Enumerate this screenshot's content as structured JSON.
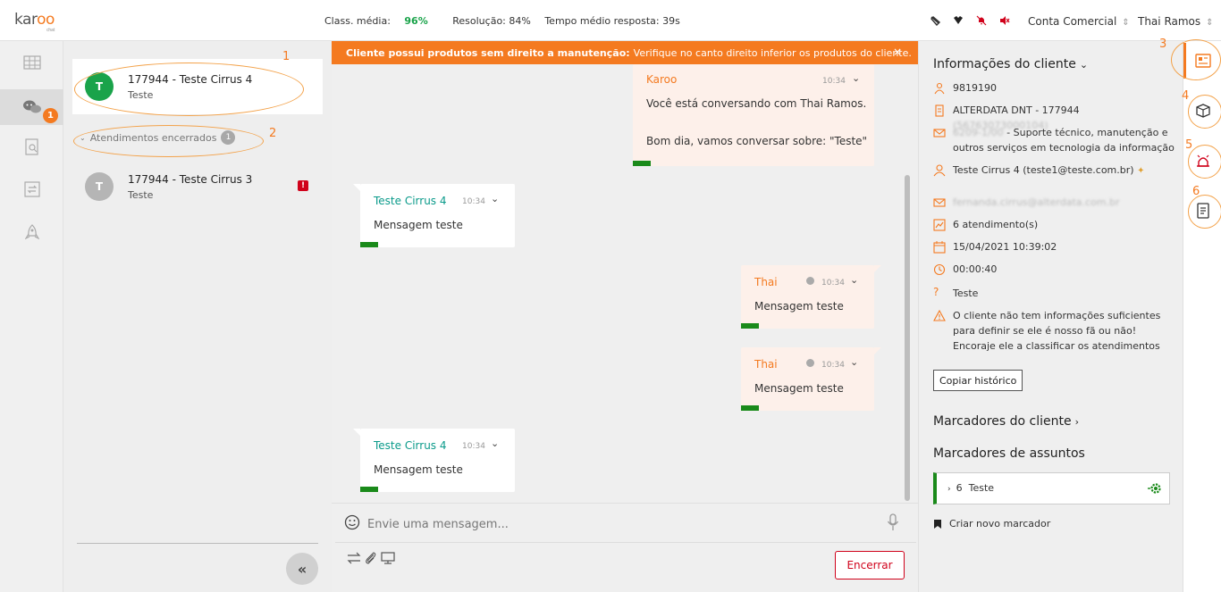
{
  "header": {
    "logo_text_a": "kar",
    "logo_text_b": "oo",
    "logo_sub": "chat",
    "stat_class_label": "Class. média:",
    "stat_class_value": "96%",
    "stat_resolution": "Resolução: 84%",
    "stat_response": "Tempo médio resposta: 39s",
    "account_label": "Conta Comercial",
    "user_label": "Thai Ramos",
    "icons": [
      "broom-icon",
      "heart-icon",
      "bell-off-icon",
      "volume-off-icon"
    ]
  },
  "leftnav": {
    "chat_badge": "1",
    "items": [
      "grid-icon",
      "chat-icon",
      "search-doc-icon",
      "transfer-icon",
      "rocket-icon"
    ]
  },
  "conversations": {
    "active": {
      "avatar": "T",
      "title": "177944 - Teste Cirrus 4",
      "subtitle": "Teste"
    },
    "closed_label": "Atendimentos encerrados",
    "closed_count": "1",
    "closed": [
      {
        "avatar": "T",
        "title": "177944 - Teste Cirrus 3",
        "subtitle": "Teste",
        "alert": "!"
      }
    ]
  },
  "annotations": [
    "1",
    "2",
    "3",
    "4",
    "5",
    "6"
  ],
  "chat": {
    "banner_bold": "Cliente possui produtos sem direito a manutenção:",
    "banner_text": "Verifique no canto direito inferior os produtos do cliente.",
    "banner_close": "×",
    "messages": [
      {
        "sender": "Karoo",
        "time": "10:34",
        "line1": "Você está conversando com Thai Ramos.",
        "line2": "Bom dia, vamos conversar sobre: \"Teste\""
      },
      {
        "sender": "Teste Cirrus 4",
        "time": "10:34",
        "line1": "Mensagem teste"
      },
      {
        "sender": "Thai",
        "time": "10:34",
        "line1": "Mensagem teste"
      },
      {
        "sender": "Thai",
        "time": "10:34",
        "line1": "Mensagem teste"
      },
      {
        "sender": "Teste Cirrus 4",
        "time": "10:34",
        "line1": "Mensagem teste"
      }
    ],
    "input_placeholder": "Envie uma mensagem...",
    "end_button": "Encerrar"
  },
  "client_info": {
    "title": "Informações do cliente",
    "code": "9819190",
    "company": "ALTERDATA DNT - 177944",
    "company_blur": "(56763073000104)",
    "activity_blur": "6209-1/00",
    "activity_text": "- Suporte técnico, manutenção e outros serviços em tecnologia da informação",
    "contact": "Teste Cirrus 4 (teste1@teste.com.br)",
    "email_blur": "fernanda.cirrus@alterdata.com.br",
    "attendances": "6 atendimento(s)",
    "datetime": "15/04/2021 10:39:02",
    "duration": "00:00:40",
    "subject": "Teste",
    "warning": "O cliente não tem informações suficientes para definir se ele é nosso fã ou não! Encoraje ele a classificar os atendimentos",
    "copy_button": "Copiar histórico",
    "client_markers": "Marcadores do cliente",
    "subject_markers": "Marcadores de assuntos",
    "marker_count": "6",
    "marker_name": "Teste",
    "new_marker": "Criar novo marcador"
  },
  "rightbar": {
    "icons": [
      "client-card-icon",
      "box-icon",
      "alarm-icon",
      "notes-icon"
    ]
  },
  "colors": {
    "accent": "#f47a20",
    "green": "#1aa34a",
    "red": "#d0021b",
    "teal": "#0a9a8a"
  }
}
